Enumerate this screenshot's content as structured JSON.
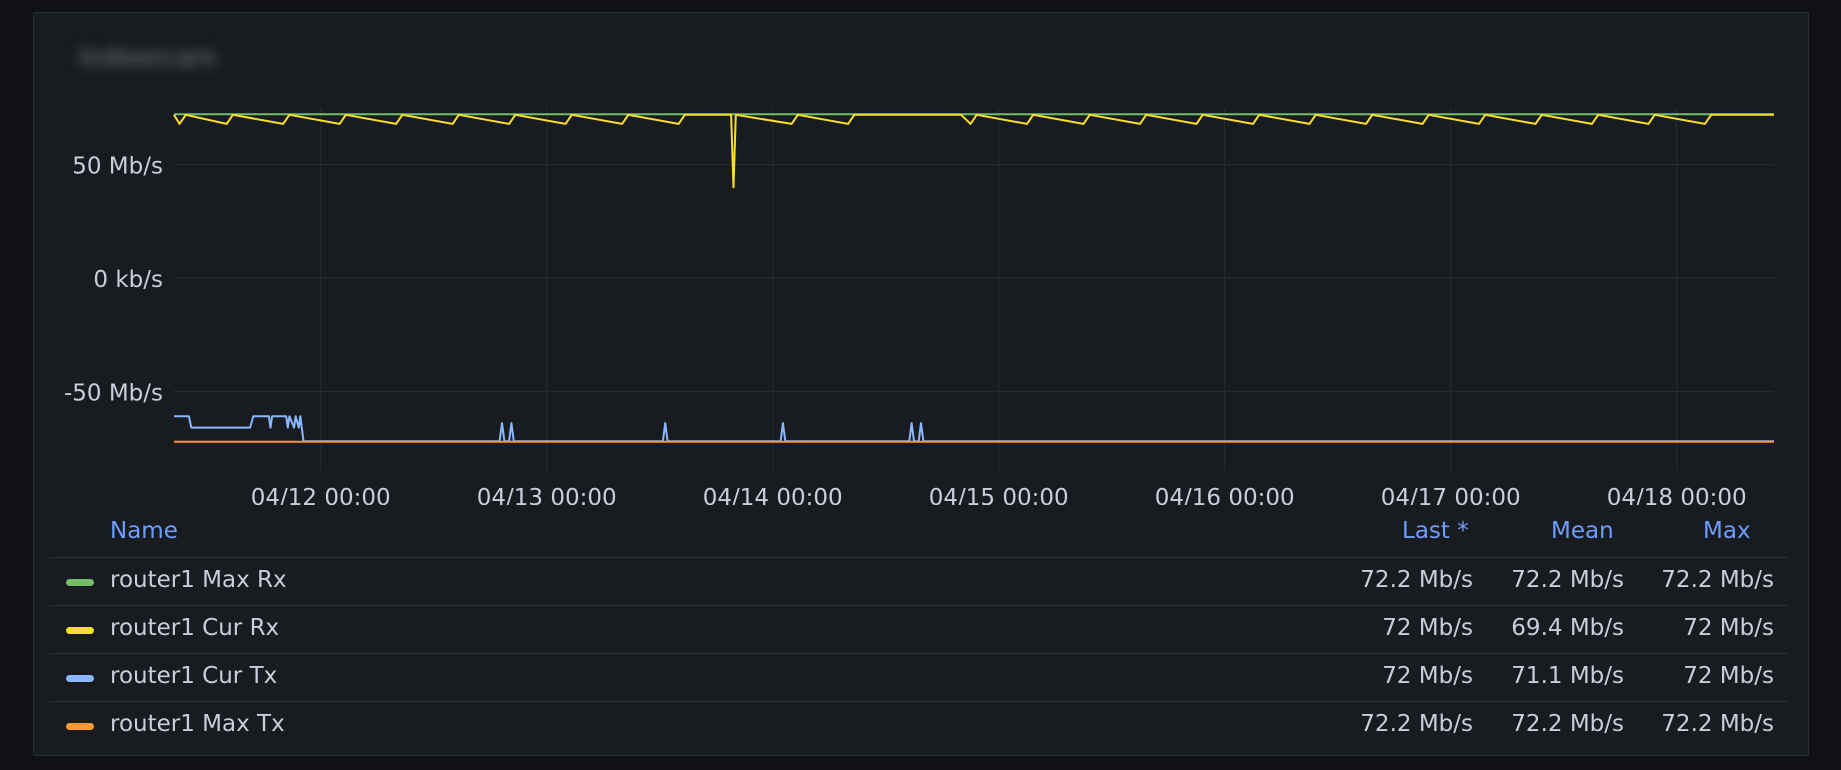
{
  "panel": {
    "title": "Indoorcam"
  },
  "legend": {
    "headers": {
      "name": "Name",
      "last": "Last *",
      "mean": "Mean",
      "max": "Max"
    },
    "rows": [
      {
        "name": "router1 Max Rx",
        "color": "#73bf69",
        "last": "72.2 Mb/s",
        "mean": "72.2 Mb/s",
        "max": "72.2 Mb/s"
      },
      {
        "name": "router1 Cur Rx",
        "color": "#fade2a",
        "last": "72 Mb/s",
        "mean": "69.4 Mb/s",
        "max": "72 Mb/s"
      },
      {
        "name": "router1 Cur Tx",
        "color": "#8ab8ff",
        "last": "72 Mb/s",
        "mean": "71.1 Mb/s",
        "max": "72 Mb/s"
      },
      {
        "name": "router1 Max Tx",
        "color": "#ff9830",
        "last": "72.2 Mb/s",
        "mean": "72.2 Mb/s",
        "max": "72.2 Mb/s"
      }
    ]
  },
  "chart_data": {
    "type": "line",
    "y_unit": "Mb/s",
    "ylim": [
      -75,
      75
    ],
    "y_ticks": [
      {
        "value": 50,
        "label": "50 Mb/s"
      },
      {
        "value": 0,
        "label": "0 kb/s"
      },
      {
        "value": -50,
        "label": "-50 Mb/s"
      }
    ],
    "x_range": [
      "2024-04-11T08:25",
      "2024-04-18T10:20"
    ],
    "x_ticks": [
      {
        "value": "2024-04-12T00:00",
        "label": "04/12 00:00"
      },
      {
        "value": "2024-04-13T00:00",
        "label": "04/13 00:00"
      },
      {
        "value": "2024-04-14T00:00",
        "label": "04/14 00:00"
      },
      {
        "value": "2024-04-15T00:00",
        "label": "04/15 00:00"
      },
      {
        "value": "2024-04-16T00:00",
        "label": "04/16 00:00"
      },
      {
        "value": "2024-04-17T00:00",
        "label": "04/17 00:00"
      },
      {
        "value": "2024-04-18T00:00",
        "label": "04/18 00:00"
      }
    ],
    "grid": true,
    "series": [
      {
        "name": "router1 Max Rx",
        "color": "#73bf69",
        "points": [
          [
            "2024-04-11T08:25",
            72.2
          ],
          [
            "2024-04-18T10:20",
            72.2
          ]
        ]
      },
      {
        "name": "router1 Cur Rx",
        "color": "#fade2a",
        "points": [
          [
            "2024-04-11T08:25",
            72.0
          ],
          [
            "2024-04-11T09:00",
            68.0
          ],
          [
            "2024-04-11T09:40",
            72.0
          ],
          [
            "2024-04-11T14:00",
            68.0
          ],
          [
            "2024-04-11T14:40",
            72.0
          ],
          [
            "2024-04-11T20:00",
            68.0
          ],
          [
            "2024-04-11T20:40",
            72.0
          ],
          [
            "2024-04-12T02:00",
            68.0
          ],
          [
            "2024-04-12T02:40",
            72.0
          ],
          [
            "2024-04-12T08:00",
            68.0
          ],
          [
            "2024-04-12T08:40",
            72.0
          ],
          [
            "2024-04-12T14:00",
            68.0
          ],
          [
            "2024-04-12T14:40",
            72.0
          ],
          [
            "2024-04-12T20:00",
            68.0
          ],
          [
            "2024-04-12T20:40",
            72.0
          ],
          [
            "2024-04-13T02:00",
            68.0
          ],
          [
            "2024-04-13T02:40",
            72.0
          ],
          [
            "2024-04-13T08:00",
            68.0
          ],
          [
            "2024-04-13T08:40",
            72.0
          ],
          [
            "2024-04-13T14:00",
            68.0
          ],
          [
            "2024-04-13T14:40",
            72.0
          ],
          [
            "2024-04-13T19:35",
            72.0
          ],
          [
            "2024-04-13T19:50",
            40.0
          ],
          [
            "2024-04-13T20:05",
            72.0
          ],
          [
            "2024-04-14T02:00",
            68.0
          ],
          [
            "2024-04-14T02:40",
            72.0
          ],
          [
            "2024-04-14T08:00",
            68.0
          ],
          [
            "2024-04-14T08:40",
            72.0
          ],
          [
            "2024-04-14T14:40",
            72.0
          ],
          [
            "2024-04-14T20:00",
            72.0
          ],
          [
            "2024-04-14T21:00",
            68.0
          ],
          [
            "2024-04-14T21:40",
            72.0
          ],
          [
            "2024-04-15T03:00",
            68.0
          ],
          [
            "2024-04-15T03:40",
            72.0
          ],
          [
            "2024-04-15T09:00",
            68.0
          ],
          [
            "2024-04-15T09:40",
            72.0
          ],
          [
            "2024-04-15T15:00",
            68.0
          ],
          [
            "2024-04-15T15:40",
            72.0
          ],
          [
            "2024-04-15T21:00",
            68.0
          ],
          [
            "2024-04-15T21:40",
            72.0
          ],
          [
            "2024-04-16T03:00",
            68.0
          ],
          [
            "2024-04-16T03:40",
            72.0
          ],
          [
            "2024-04-16T09:00",
            68.0
          ],
          [
            "2024-04-16T09:40",
            72.0
          ],
          [
            "2024-04-16T15:00",
            68.0
          ],
          [
            "2024-04-16T15:40",
            72.0
          ],
          [
            "2024-04-16T21:00",
            68.0
          ],
          [
            "2024-04-16T21:40",
            72.0
          ],
          [
            "2024-04-17T03:00",
            68.0
          ],
          [
            "2024-04-17T03:40",
            72.0
          ],
          [
            "2024-04-17T09:00",
            68.0
          ],
          [
            "2024-04-17T09:40",
            72.0
          ],
          [
            "2024-04-17T15:00",
            68.0
          ],
          [
            "2024-04-17T15:40",
            72.0
          ],
          [
            "2024-04-17T21:00",
            68.0
          ],
          [
            "2024-04-17T21:40",
            72.0
          ],
          [
            "2024-04-18T03:00",
            68.0
          ],
          [
            "2024-04-18T03:40",
            72.0
          ],
          [
            "2024-04-18T10:20",
            72.0
          ]
        ]
      },
      {
        "name": "router1 Cur Tx",
        "color": "#8ab8ff",
        "points": [
          [
            "2024-04-11T08:25",
            -61.0
          ],
          [
            "2024-04-11T10:00",
            -61.0
          ],
          [
            "2024-04-11T10:15",
            -66.0
          ],
          [
            "2024-04-11T16:30",
            -66.0
          ],
          [
            "2024-04-11T16:50",
            -61.0
          ],
          [
            "2024-04-11T18:30",
            -61.0
          ],
          [
            "2024-04-11T18:40",
            -66.0
          ],
          [
            "2024-04-11T18:50",
            -61.0
          ],
          [
            "2024-04-11T20:20",
            -61.0
          ],
          [
            "2024-04-11T20:30",
            -66.0
          ],
          [
            "2024-04-11T20:40",
            -61.0
          ],
          [
            "2024-04-11T21:10",
            -66.0
          ],
          [
            "2024-04-11T21:20",
            -61.0
          ],
          [
            "2024-04-11T21:40",
            -66.0
          ],
          [
            "2024-04-11T21:50",
            -61.0
          ],
          [
            "2024-04-11T22:10",
            -72.0
          ],
          [
            "2024-04-12T19:00",
            -72.0
          ],
          [
            "2024-04-12T19:15",
            -64.0
          ],
          [
            "2024-04-12T19:30",
            -72.0
          ],
          [
            "2024-04-12T20:00",
            -72.0
          ],
          [
            "2024-04-12T20:15",
            -64.0
          ],
          [
            "2024-04-12T20:30",
            -72.0
          ],
          [
            "2024-04-13T12:20",
            -72.0
          ],
          [
            "2024-04-13T12:35",
            -64.0
          ],
          [
            "2024-04-13T12:50",
            -72.0
          ],
          [
            "2024-04-14T00:50",
            -72.0
          ],
          [
            "2024-04-14T01:05",
            -64.0
          ],
          [
            "2024-04-14T01:20",
            -72.0
          ],
          [
            "2024-04-14T14:30",
            -72.0
          ],
          [
            "2024-04-14T14:45",
            -64.0
          ],
          [
            "2024-04-14T15:00",
            -72.0
          ],
          [
            "2024-04-14T15:30",
            -72.0
          ],
          [
            "2024-04-14T15:45",
            -64.0
          ],
          [
            "2024-04-14T16:00",
            -72.0
          ],
          [
            "2024-04-18T10:20",
            -72.0
          ]
        ]
      },
      {
        "name": "router1 Max Tx",
        "color": "#ff9830",
        "points": [
          [
            "2024-04-11T08:25",
            -72.2
          ],
          [
            "2024-04-18T10:20",
            -72.2
          ]
        ]
      }
    ]
  }
}
